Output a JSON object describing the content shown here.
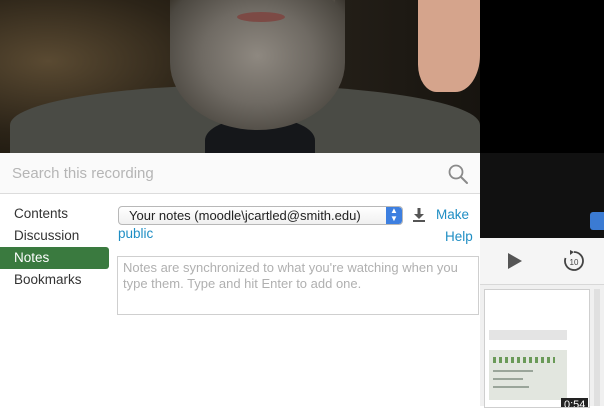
{
  "search": {
    "placeholder": "Search this recording",
    "icon": "search-icon"
  },
  "nav": {
    "items": [
      {
        "label": "Contents",
        "active": false
      },
      {
        "label": "Discussion",
        "active": false
      },
      {
        "label": "Notes",
        "active": true
      },
      {
        "label": "Bookmarks",
        "active": false
      }
    ]
  },
  "notes": {
    "selected_notebook": "Your notes (moodle\\jcartled@smith.edu)",
    "make_public_part1": "Make",
    "make_public_part2": "public",
    "help": "Help",
    "textarea_placeholder": "Notes are synchronized to what you're watching when you type them. Type and hit Enter to add one."
  },
  "player": {
    "duration_label": "0:54",
    "rewind_seconds": "10"
  },
  "colors": {
    "active_nav": "#3a7a3f",
    "link": "#1f8ec4",
    "select_accent": "#3d7fe0"
  }
}
